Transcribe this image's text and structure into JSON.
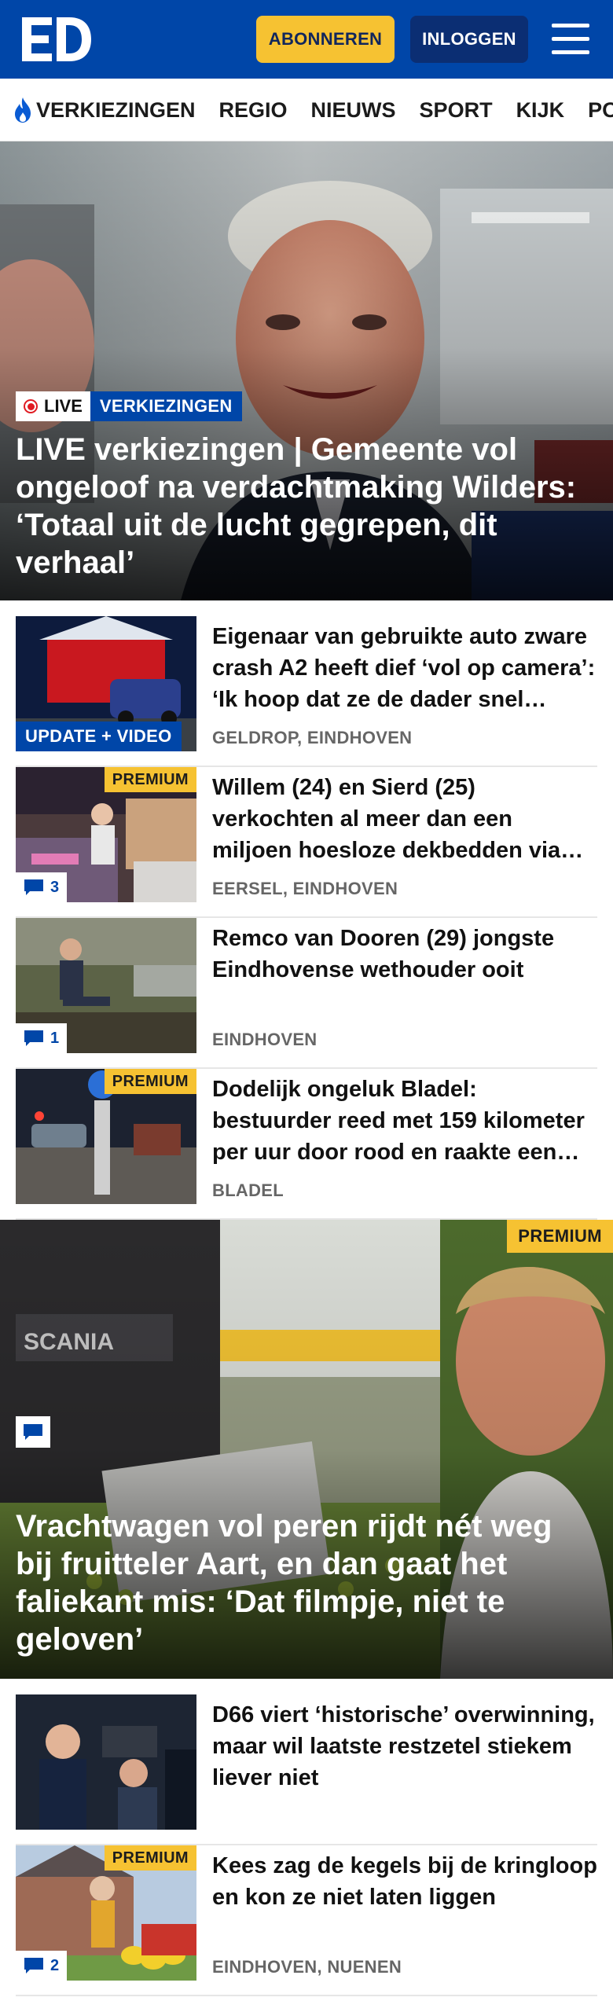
{
  "header": {
    "logo_text": "ED",
    "subscribe_label": "ABONNEREN",
    "login_label": "INLOGGEN",
    "brand_color": "#0046a8",
    "accent_color": "#f6c232"
  },
  "nav": {
    "items": [
      {
        "label": "VERKIEZINGEN",
        "icon": "flame-icon"
      },
      {
        "label": "REGIO"
      },
      {
        "label": "NIEUWS"
      },
      {
        "label": "SPORT"
      },
      {
        "label": "KIJK"
      },
      {
        "label": "PODCASTS"
      }
    ]
  },
  "hero": {
    "live_label": "LIVE",
    "category": "VERKIEZINGEN",
    "title": "LIVE verkiezingen | Gemeente vol ongeloof na verdachtmaking Wilders: ‘Totaal uit de lucht gegrepen, dit verhaal’"
  },
  "articles": [
    {
      "title": "Eigenaar van gebruikte auto zware crash A2 heeft dief ‘vol op camera’: ‘Ik hoop dat ze de dader snel vinden’",
      "location": "GELDROP, EINDHOVEN",
      "tag": "UPDATE + VIDEO"
    },
    {
      "title": "Willem (24) en Sierd (25) verkochten al meer dan een miljoen hoesloze dekbedden via internet",
      "location": "EERSEL, EINDHOVEN",
      "premium": "PREMIUM",
      "comments": "3"
    },
    {
      "title": "Remco van Dooren (29) jongste Eindhovense wethouder ooit",
      "location": "EINDHOVEN",
      "comments": "1"
    },
    {
      "title": "Dodelijk ongeluk Bladel: bestuurder reed met 159 kilometer per uur door rood en raakte een motorrijder",
      "location": "BLADEL",
      "premium": "PREMIUM"
    }
  ],
  "feature": {
    "premium": "PREMIUM",
    "title": "Vrachtwagen vol peren rijdt nét weg bij fruitteler Aart, en dan gaat het faliekant mis: ‘Dat filmpje, niet te geloven’"
  },
  "articles_more": [
    {
      "title": "D66 viert ‘historische’ overwin­ning, maar wil laatste restzetel stiekem liever niet",
      "location": ""
    },
    {
      "title": "Kees zag de kegels bij de kringloop en kon ze niet laten liggen",
      "location": "EINDHOVEN, NUENEN",
      "premium": "PREMIUM",
      "comments": "2"
    }
  ]
}
